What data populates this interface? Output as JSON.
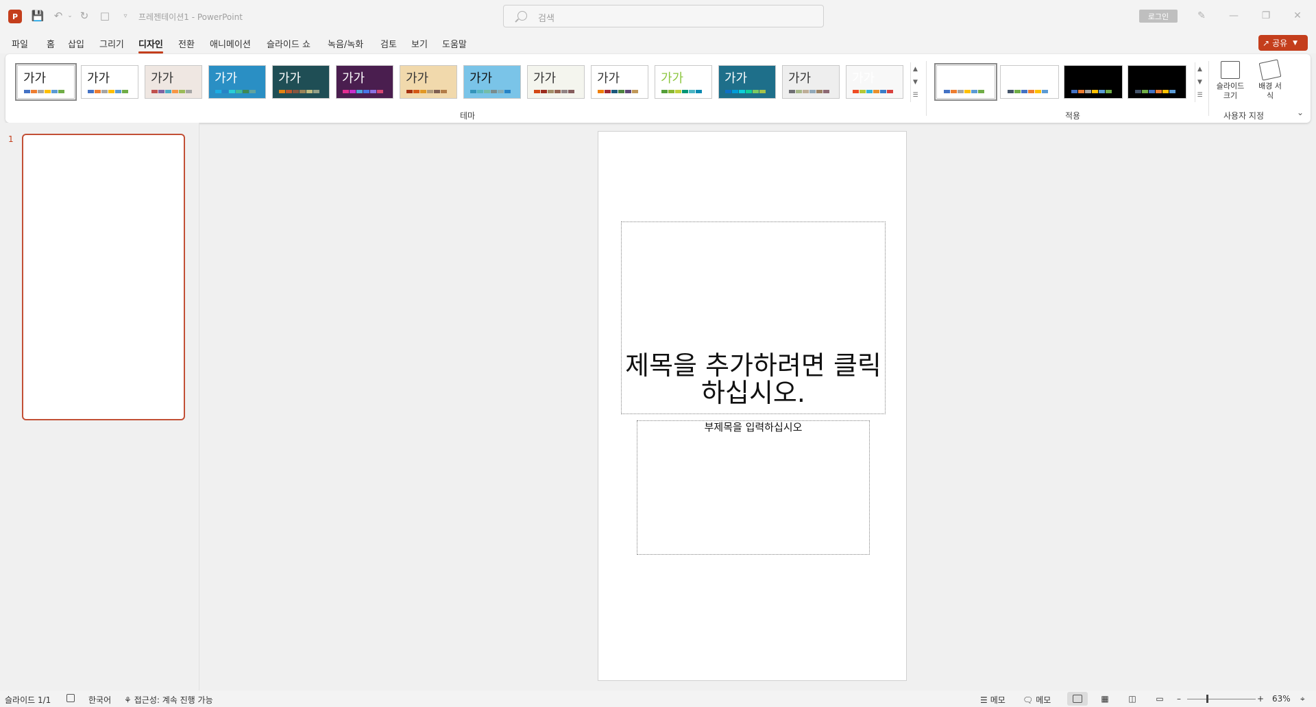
{
  "app": {
    "app_icon_letter": "P",
    "doc_title": "프레젠테이션1  -  PowerPoint",
    "search_placeholder": "검색",
    "login_label": "로그인",
    "share_label": "공유",
    "accent_color": "#c43e1c"
  },
  "menu": {
    "items": [
      "파일",
      "홈",
      "삽입",
      "그리기",
      "디자인",
      "전환",
      "애니메이션",
      "슬라이드 쇼",
      "녹음/녹화",
      "검토",
      "보기",
      "도움말"
    ],
    "active": "디자인"
  },
  "ribbon": {
    "themes_group_label": "테마",
    "variants_group_label": "적용",
    "customize_group_label": "사용자 지정",
    "theme_sample_text": "가가",
    "slide_size_label": "슬라이드 크기",
    "format_background_label": "배경 서식"
  },
  "themes": [
    {
      "bg": "#ffffff",
      "fg": "#222222",
      "colors": [
        "#4472c4",
        "#ed7d31",
        "#a5a5a5",
        "#ffc000",
        "#5b9bd5",
        "#70ad47"
      ]
    },
    {
      "bg": "#ffffff",
      "fg": "#222222",
      "colors": [
        "#4472c4",
        "#ed7d31",
        "#a5a5a5",
        "#ffc000",
        "#5b9bd5",
        "#70ad47"
      ]
    },
    {
      "bg": "#efe7e2",
      "fg": "#333333",
      "colors": [
        "#c0504d",
        "#8064a2",
        "#4bacc6",
        "#f79646",
        "#9bbb59",
        "#a5a5a5"
      ]
    },
    {
      "bg": "#2a8fc4",
      "fg": "#ffffff",
      "colors": [
        "#1cade4",
        "#2683c6",
        "#27ced7",
        "#42ba97",
        "#3e8853",
        "#62a39f"
      ]
    },
    {
      "bg": "#1f4e55",
      "fg": "#ffffff",
      "colors": [
        "#e48312",
        "#bd582c",
        "#865640",
        "#9b8357",
        "#c2bc80",
        "#94a088"
      ]
    },
    {
      "bg": "#4a1e4f",
      "fg": "#ffffff",
      "colors": [
        "#e32d91",
        "#c830cc",
        "#4ea6dc",
        "#4775e7",
        "#8971e1",
        "#d54773"
      ]
    },
    {
      "bg": "#f1d9ac",
      "fg": "#333333",
      "colors": [
        "#a5300f",
        "#d55816",
        "#e19825",
        "#b19c7d",
        "#7f5f52",
        "#b27d49"
      ]
    },
    {
      "bg": "#7ac4e8",
      "fg": "#111111",
      "colors": [
        "#3494ba",
        "#58b6c0",
        "#75bda7",
        "#7a8c8e",
        "#84acb6",
        "#2683c6"
      ]
    },
    {
      "bg": "#f4f5ee",
      "fg": "#333333",
      "colors": [
        "#d34817",
        "#9b2d1f",
        "#a28e6a",
        "#956251",
        "#918485",
        "#855d5d"
      ]
    },
    {
      "bg": "#ffffff",
      "fg": "#333333",
      "colors": [
        "#f07f09",
        "#9f2936",
        "#1b587c",
        "#4e8542",
        "#604878",
        "#c19859"
      ]
    },
    {
      "bg": "#ffffff",
      "fg": "#8cc63f",
      "colors": [
        "#549e39",
        "#8ab833",
        "#c0cf3a",
        "#029676",
        "#4ab5c4",
        "#0989b1"
      ]
    },
    {
      "bg": "#1e6f8a",
      "fg": "#ffffff",
      "colors": [
        "#0f6fc6",
        "#009dd9",
        "#0bd0d9",
        "#10cf9b",
        "#7cca62",
        "#a5c249"
      ]
    },
    {
      "bg": "#eeeeee",
      "fg": "#333333",
      "colors": [
        "#6f6f74",
        "#a7b789",
        "#beae98",
        "#92a9b9",
        "#9c8265",
        "#8d6974"
      ]
    },
    {
      "bg": "#f8f8f8",
      "fg": "#ffffff",
      "colors": [
        "#ee4c24",
        "#b5c835",
        "#34b3d9",
        "#e9902c",
        "#3b7dc8",
        "#d8413e"
      ]
    }
  ],
  "variants": [
    {
      "bg": "#ffffff",
      "colors": [
        "#4472c4",
        "#ed7d31",
        "#a5a5a5",
        "#ffc000",
        "#5b9bd5",
        "#70ad47"
      ]
    },
    {
      "bg": "#ffffff",
      "colors": [
        "#44546a",
        "#70ad47",
        "#4472c4",
        "#ed7d31",
        "#ffc000",
        "#5b9bd5"
      ]
    },
    {
      "bg": "#000000",
      "colors": [
        "#4472c4",
        "#ed7d31",
        "#a5a5a5",
        "#ffc000",
        "#5b9bd5",
        "#70ad47"
      ]
    },
    {
      "bg": "#000000",
      "colors": [
        "#44546a",
        "#70ad47",
        "#4472c4",
        "#ed7d31",
        "#ffc000",
        "#5b9bd5"
      ]
    }
  ],
  "thumbnails": {
    "slide_number": "1"
  },
  "slide": {
    "title_placeholder": "제목을 추가하려면 클릭하십시오.",
    "subtitle_placeholder": "부제목을 입력하십시오"
  },
  "status": {
    "slide_count": "슬라이드 1/1",
    "language": "한국어",
    "accessibility": "접근성: 계속 진행 가능",
    "notes_label": "메모",
    "comments_label": "메모",
    "zoom": "63%"
  }
}
